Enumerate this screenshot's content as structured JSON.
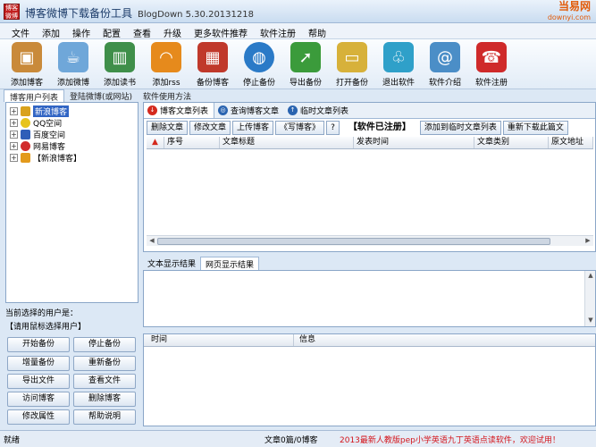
{
  "window": {
    "title": "博客微博下载备份工具",
    "version": "BlogDown 5.30.20131218",
    "logo_text": "博客 微博",
    "watermark_line1": "当易网",
    "watermark_line2": "downyi.com"
  },
  "menu": [
    "文件",
    "添加",
    "操作",
    "配置",
    "查看",
    "升级",
    "更多软件推荐",
    "软件注册",
    "帮助"
  ],
  "toolbar": [
    {
      "label": "添加博客",
      "icon": "box-icon",
      "color": "#c98a3a"
    },
    {
      "label": "添加微博",
      "icon": "cup-icon",
      "color": "#6fa7d9"
    },
    {
      "label": "添加读书",
      "icon": "books-icon",
      "color": "#3f8f4a"
    },
    {
      "label": "添加rss",
      "icon": "rss-icon",
      "color": "#e68a1c"
    },
    {
      "label": "备份博客",
      "icon": "cube-icon",
      "color": "#c0392b"
    },
    {
      "label": "停止备份",
      "icon": "globe-icon",
      "color": "#2a7ac7"
    },
    {
      "label": "导出备份",
      "icon": "export-icon",
      "color": "#3b9b3b"
    },
    {
      "label": "打开备份",
      "icon": "folder-tv-icon",
      "color": "#d7b13a"
    },
    {
      "label": "退出软件",
      "icon": "basket-icon",
      "color": "#2fa0c9"
    },
    {
      "label": "软件介绍",
      "icon": "notebook-icon",
      "color": "#4b8ec7"
    },
    {
      "label": "软件注册",
      "icon": "phone-icon",
      "color": "#cf2a2a"
    }
  ],
  "main_tabs": [
    "博客用户列表",
    "登陆微博(或网站)",
    "软件使用方法"
  ],
  "tree": [
    {
      "label": "新浪博客",
      "color": "#d9a21c",
      "selected": true
    },
    {
      "label": "QQ空间",
      "color": "#e7c31c",
      "selected": false
    },
    {
      "label": "百度空间",
      "color": "#2f5fb8",
      "selected": false
    },
    {
      "label": "网易博客",
      "color": "#d12a2a",
      "selected": false
    },
    {
      "label": "【新浪博客】",
      "color": "#e39a1c",
      "selected": false
    }
  ],
  "current_user": {
    "title": "当前选择的用户是：",
    "hint": "【请用鼠标选择用户】"
  },
  "actions": [
    "开始备份",
    "停止备份",
    "增量备份",
    "重新备份",
    "导出文件",
    "查看文件",
    "访问博客",
    "删除博客",
    "修改属性",
    "帮助说明"
  ],
  "article_tabs": [
    "博客文章列表",
    "查询博客文章",
    "临时文章列表"
  ],
  "article_actions": {
    "delete": "删除文章",
    "edit": "修改文章",
    "upload": "上传博客",
    "write": "《写博客》",
    "help": "?",
    "registered": "【软件已注册】",
    "add_temp": "添加到临时文章列表",
    "redownload": "重新下载此篇文"
  },
  "article_columns": [
    "序号",
    "文章标题",
    "发表时间",
    "文章类别",
    "原文地址"
  ],
  "result_tabs": [
    "文本显示结果",
    "网页显示结果"
  ],
  "log_columns": [
    "时间",
    "信息"
  ],
  "status": {
    "left": "就绪",
    "count": "文章0篇/0博客",
    "ad": "2013最新人教版pep小学英语九丁英语点读软件，欢迎试用！"
  }
}
